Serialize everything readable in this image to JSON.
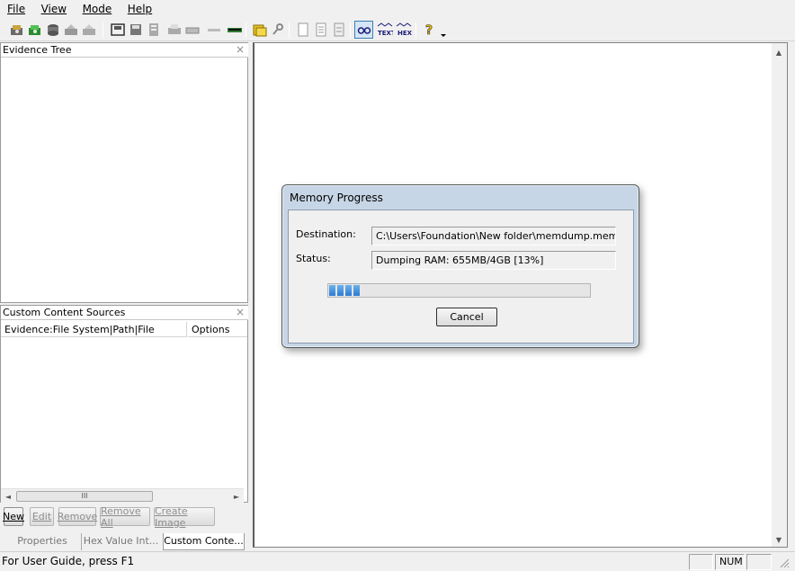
{
  "menu": [
    "File",
    "View",
    "Mode",
    "Help"
  ],
  "toolbar": {
    "icons": [
      "add-evidence-icon",
      "add-evidence-green-icon",
      "remove-evidence-icon",
      "image-icon",
      "image-folder-icon",
      "save-icon",
      "floppy-icon",
      "export-icon",
      "print-icon",
      "disk-icon",
      "memory-icon",
      "ram-icon",
      "folder-icon",
      "key-icon",
      "page-icon",
      "page-text-icon",
      "page-lines-icon",
      "glasses-icon",
      "text-view-icon",
      "hex-view-icon",
      "help-icon"
    ],
    "text_label": "TEXT",
    "hex_label": "HEX"
  },
  "evidence_tree": {
    "title": "Evidence Tree",
    "close": "×"
  },
  "custom_content": {
    "title": "Custom Content Sources",
    "close": "×",
    "columns": [
      "Evidence:File System|Path|File",
      "Options"
    ],
    "scroll_thumb": "III",
    "buttons": {
      "new": "New",
      "edit": "Edit",
      "remove": "Remove",
      "remove_all": "Remove All",
      "create_image": "Create Image"
    }
  },
  "bottom_tabs": [
    "Properties",
    "Hex Value Int...",
    "Custom Conte..."
  ],
  "dialog": {
    "title": "Memory Progress",
    "destination_label": "Destination:",
    "destination_value": "C:\\Users\\Foundation\\New folder\\memdump.mem",
    "status_label": "Status:",
    "status_value": "Dumping RAM: 655MB/4GB [13%]",
    "progress_percent": 13,
    "cancel": "Cancel"
  },
  "statusbar": {
    "text": "For User Guide, press F1",
    "num": "NUM"
  },
  "colors": {
    "dialog_frame": "#c7d6e6",
    "progress": "#2a7bd2"
  }
}
